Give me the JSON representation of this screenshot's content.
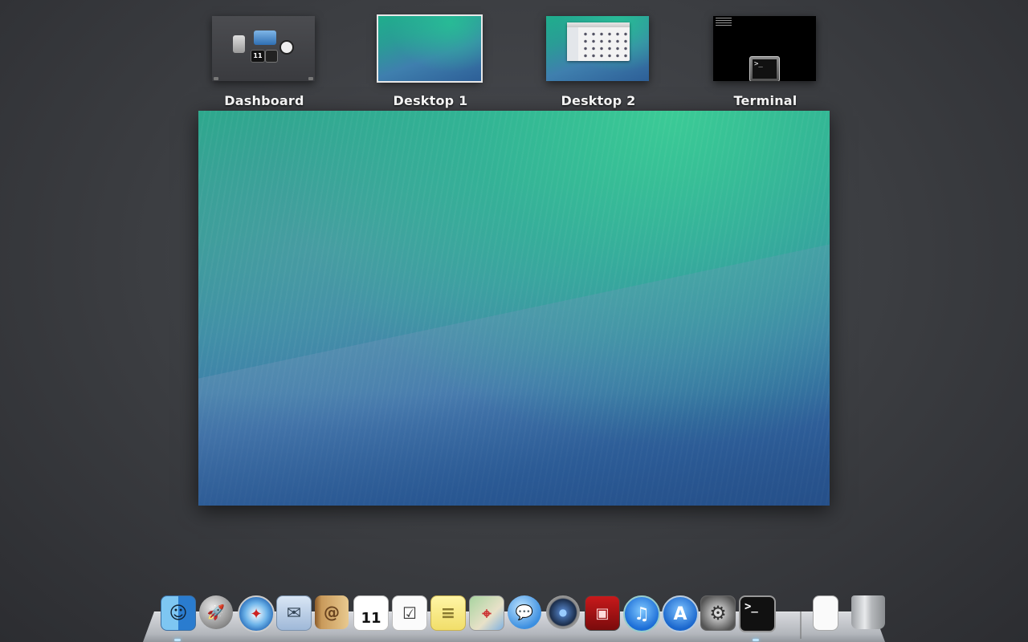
{
  "spaces": [
    {
      "id": "dashboard",
      "label": "Dashboard",
      "selected": false
    },
    {
      "id": "desktop1",
      "label": "Desktop 1",
      "selected": true
    },
    {
      "id": "desktop2",
      "label": "Desktop 2",
      "selected": false
    },
    {
      "id": "terminal",
      "label": "Terminal",
      "selected": false
    }
  ],
  "dashboard_thumb": {
    "calendar_day": "11"
  },
  "terminal_thumb": {
    "prompt": ">_"
  },
  "dock": {
    "items": [
      {
        "name": "finder-icon",
        "glyph": "☺",
        "running": true
      },
      {
        "name": "launchpad-icon",
        "glyph": "🚀",
        "running": false
      },
      {
        "name": "safari-icon",
        "glyph": "✦",
        "running": false
      },
      {
        "name": "mail-icon",
        "glyph": "✉",
        "running": false
      },
      {
        "name": "contacts-icon",
        "glyph": "@",
        "running": false
      },
      {
        "name": "calendar-icon",
        "glyph": "11",
        "running": false
      },
      {
        "name": "reminders-icon",
        "glyph": "☑",
        "running": false
      },
      {
        "name": "notes-icon",
        "glyph": "≡",
        "running": false
      },
      {
        "name": "maps-icon",
        "glyph": "⌖",
        "running": false
      },
      {
        "name": "messages-icon",
        "glyph": "💬",
        "running": false
      },
      {
        "name": "facetime-icon",
        "glyph": "●",
        "running": false
      },
      {
        "name": "photo-booth-icon",
        "glyph": "▣",
        "running": false
      },
      {
        "name": "itunes-icon",
        "glyph": "♫",
        "running": false
      },
      {
        "name": "app-store-icon",
        "glyph": "A",
        "running": false
      },
      {
        "name": "system-preferences-icon",
        "glyph": "⚙",
        "running": false
      },
      {
        "name": "terminal-icon",
        "glyph": ">_",
        "running": true
      },
      {
        "name": "document-icon",
        "glyph": "",
        "running": false
      },
      {
        "name": "trash-icon",
        "glyph": "",
        "running": false
      }
    ]
  }
}
